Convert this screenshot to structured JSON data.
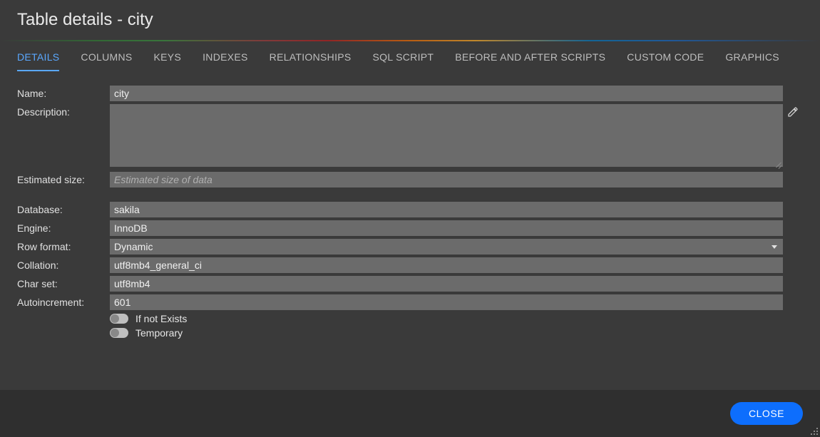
{
  "title": "Table details - city",
  "tabs": [
    {
      "label": "DETAILS",
      "active": true
    },
    {
      "label": "COLUMNS"
    },
    {
      "label": "KEYS"
    },
    {
      "label": "INDEXES"
    },
    {
      "label": "RELATIONSHIPS"
    },
    {
      "label": "SQL SCRIPT"
    },
    {
      "label": "BEFORE AND AFTER SCRIPTS"
    },
    {
      "label": "CUSTOM CODE"
    },
    {
      "label": "GRAPHICS"
    }
  ],
  "labels": {
    "name": "Name:",
    "description": "Description:",
    "estimated_size": "Estimated size:",
    "database": "Database:",
    "engine": "Engine:",
    "row_format": "Row format:",
    "collation": "Collation:",
    "char_set": "Char set:",
    "autoincrement": "Autoincrement:",
    "if_not_exists": "If not Exists",
    "temporary": "Temporary"
  },
  "fields": {
    "name": "city",
    "description": "",
    "estimated_size": "",
    "estimated_size_placeholder": "Estimated size of data",
    "database": "sakila",
    "engine": "InnoDB",
    "row_format": "Dynamic",
    "collation": "utf8mb4_general_ci",
    "char_set": "utf8mb4",
    "autoincrement": "601",
    "if_not_exists": false,
    "temporary": false
  },
  "footer": {
    "close_label": "CLOSE"
  }
}
